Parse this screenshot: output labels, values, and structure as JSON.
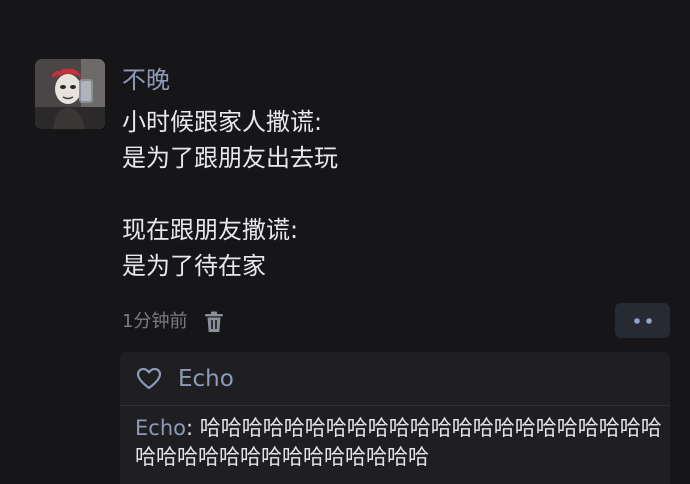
{
  "post": {
    "author": "不晚",
    "lines": [
      "小时候跟家人撒谎:",
      "是为了跟朋友出去玩",
      "",
      "现在跟朋友撒谎:",
      "是为了待在家"
    ],
    "time": "1分钟前",
    "delete_icon": "trash-icon",
    "more_icon": "more-dots-icon"
  },
  "likes": {
    "icon": "heart-outline-icon",
    "names": "Echo"
  },
  "comment": {
    "author": "Echo",
    "separator": ": ",
    "text": "哈哈哈哈哈哈哈哈哈哈哈哈哈哈哈哈哈哈哈哈哈哈哈哈哈哈哈哈哈哈哈哈哈哈哈哈"
  },
  "colors": {
    "background": "#161618",
    "name_blue": "#8e9ab8",
    "text": "#e9e9ec",
    "muted": "#7b7b80",
    "panel": "#1f1f22",
    "button": "#262a33"
  }
}
